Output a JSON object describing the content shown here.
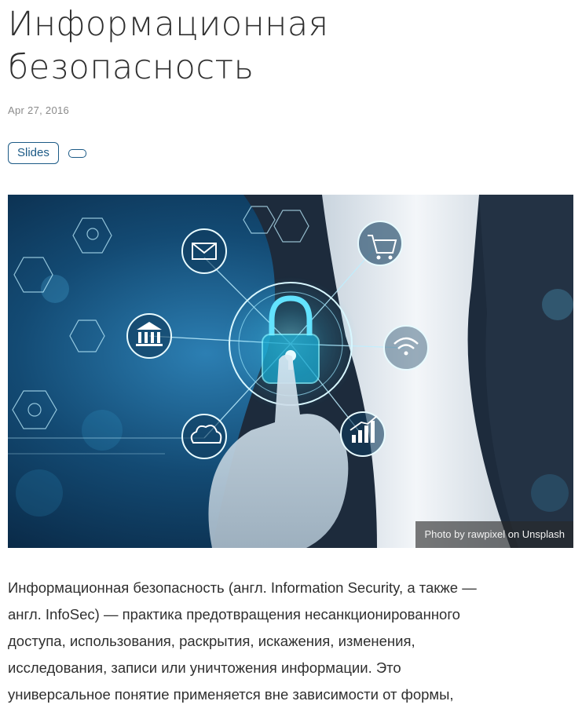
{
  "article": {
    "title_line1": "Информационная",
    "title_line2": "безопасность",
    "date": "Apr 27, 2016",
    "tags": [
      {
        "label": "Slides"
      },
      {
        "label": ""
      }
    ]
  },
  "hero": {
    "caption_prefix": "Photo by ",
    "caption_author": "rawpixel",
    "caption_middle": " on ",
    "caption_source": "Unsplash",
    "icons": [
      "padlock-icon",
      "mail-icon",
      "shopping-cart-icon",
      "wifi-icon",
      "bank-icon",
      "cloud-icon",
      "bar-chart-icon",
      "lightbulb-icon",
      "network-icon"
    ],
    "colors": {
      "background": "#0b2a45",
      "glow": "#3fd6ff",
      "suit": "#1d2b3c",
      "shirt": "#e9eef3"
    }
  },
  "body": {
    "lines": [
      "Информационная безопасность (англ. Information Security, а также —",
      "англ. InfoSec) — практика предотвращения несанкционированного",
      "доступа, использования, раскрытия, искажения, изменения,",
      "исследования, записи или уничтожения информации. Это",
      "универсальное понятие применяется вне зависимости от формы,"
    ]
  },
  "colors": {
    "accent": "#1c5a86",
    "text": "#2f2f2f",
    "muted": "#8a8a8a"
  }
}
